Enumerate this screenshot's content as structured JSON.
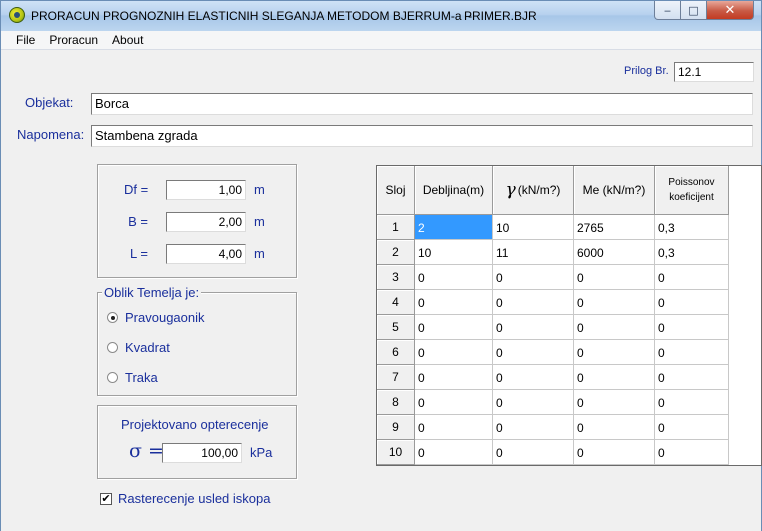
{
  "window": {
    "title": "PRORACUN PROGNOZNIH ELASTICNIH SLEGANJA METODOM BJERRUM-a  -",
    "file": "PRIMER.BJR",
    "min_glyph": "‒",
    "max_glyph": "□",
    "close_glyph": "✕"
  },
  "menu": [
    "File",
    "Proracun",
    "About"
  ],
  "prilog": {
    "label": "Prilog Br.",
    "value": "12.1"
  },
  "objekat": {
    "label": "Objekat:",
    "value": "Borca"
  },
  "napomena": {
    "label": "Napomena:",
    "value": "Stambena zgrada"
  },
  "dimensions": [
    {
      "label": "Df =",
      "value": "1,00",
      "unit": "m"
    },
    {
      "label": "B =",
      "value": "2,00",
      "unit": "m"
    },
    {
      "label": "L =",
      "value": "4,00",
      "unit": "m"
    }
  ],
  "shape_group": {
    "legend": "Oblik Temelja je:",
    "options": [
      {
        "label": "Pravougaonik",
        "selected": true
      },
      {
        "label": "Kvadrat",
        "selected": false
      },
      {
        "label": "Traka",
        "selected": false
      }
    ]
  },
  "load": {
    "title": "Projektovano opterecenje",
    "symbol": "σ =",
    "value": "100,00",
    "unit": "kPa"
  },
  "excavation": {
    "label": "Rasterecenje usled iskopa",
    "checked": true,
    "check_glyph": "✔"
  },
  "grid": {
    "headers": {
      "sloj": "Sloj",
      "debljina": "Debljina(m)",
      "gamma_symbol": "γ",
      "gamma_unit": "(kN/m?)",
      "me": "Me (kN/m?)",
      "poisson_1": "Poissonov",
      "poisson_2": "koeficijent"
    },
    "rows": [
      {
        "sloj": "1",
        "debljina": "2",
        "gamma": "10",
        "me": "2765",
        "poisson": "0,3"
      },
      {
        "sloj": "2",
        "debljina": "10",
        "gamma": "11",
        "me": "6000",
        "poisson": "0,3"
      },
      {
        "sloj": "3",
        "debljina": "0",
        "gamma": "0",
        "me": "0",
        "poisson": "0"
      },
      {
        "sloj": "4",
        "debljina": "0",
        "gamma": "0",
        "me": "0",
        "poisson": "0"
      },
      {
        "sloj": "5",
        "debljina": "0",
        "gamma": "0",
        "me": "0",
        "poisson": "0"
      },
      {
        "sloj": "6",
        "debljina": "0",
        "gamma": "0",
        "me": "0",
        "poisson": "0"
      },
      {
        "sloj": "7",
        "debljina": "0",
        "gamma": "0",
        "me": "0",
        "poisson": "0"
      },
      {
        "sloj": "8",
        "debljina": "0",
        "gamma": "0",
        "me": "0",
        "poisson": "0"
      },
      {
        "sloj": "9",
        "debljina": "0",
        "gamma": "0",
        "me": "0",
        "poisson": "0"
      },
      {
        "sloj": "10",
        "debljina": "0",
        "gamma": "0",
        "me": "0",
        "poisson": "0"
      }
    ]
  }
}
